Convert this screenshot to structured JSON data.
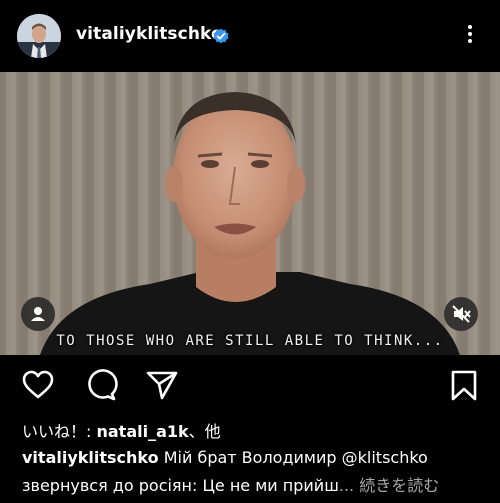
{
  "header": {
    "username": "vitaliyklitschko",
    "verified_color": "#3897f0"
  },
  "video": {
    "caption": "TO THOSE WHO ARE STILL ABLE TO THINK...",
    "sound": "muted"
  },
  "likes": {
    "prefix": "いいね！: ",
    "user": "natali_a1k",
    "suffix": "、他"
  },
  "post_caption": {
    "username": "vitaliyklitschko",
    "line1_text": " Мій брат Володимир @klitschko",
    "line2_text": "звернувся до росіян: Це не ми прийш",
    "ellipsis": "...",
    "more_label": " 続きを読む"
  }
}
